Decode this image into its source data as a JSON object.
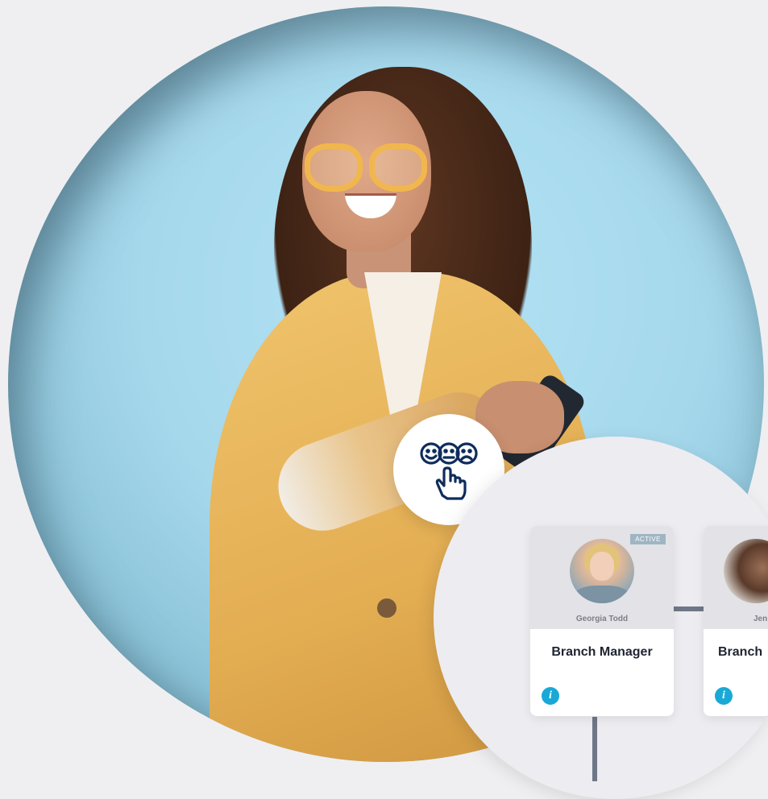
{
  "badge": {
    "icon": "feedback-emoji-tap-icon"
  },
  "org_chart": {
    "cards": [
      {
        "status": "ACTIVE",
        "person_name": "Georgia Todd",
        "role": "Branch Manager",
        "info_icon": "i"
      },
      {
        "person_name": "Jen",
        "role": "Branch",
        "info_icon": "i"
      }
    ]
  },
  "colors": {
    "background": "#efeff1",
    "hero_blue": "#a6d8ec",
    "jacket": "#e3ad52",
    "info_button": "#19a9d6",
    "badge_icon": "#0f2d5c",
    "connector": "#6e7787"
  }
}
